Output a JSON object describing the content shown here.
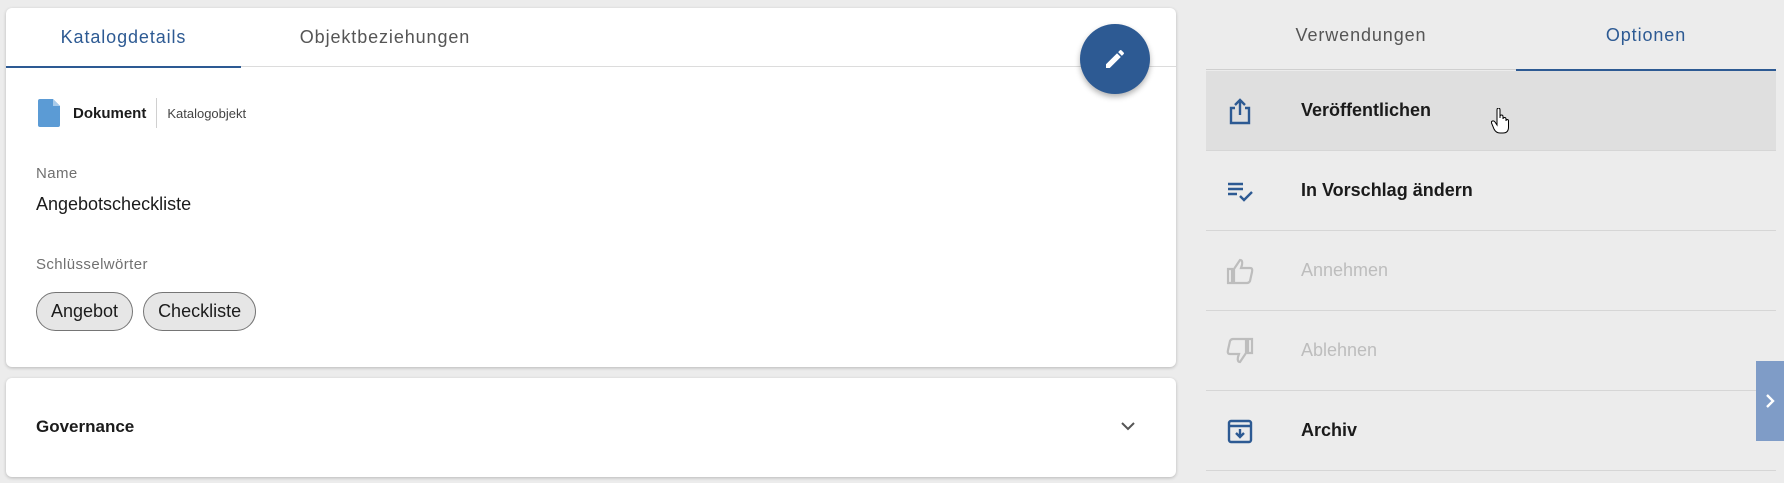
{
  "left_tabs": [
    {
      "label": "Katalogdetails",
      "active": true
    },
    {
      "label": "Objektbeziehungen",
      "active": false
    }
  ],
  "edit_button": {
    "icon": "pencil-icon"
  },
  "object_type": {
    "label": "Dokument",
    "sub_label": "Katalogobjekt",
    "icon": "document-icon"
  },
  "fields": {
    "name_label": "Name",
    "name_value": "Angebotscheckliste",
    "keywords_label": "Schlüsselwörter",
    "keywords": [
      "Angebot",
      "Checkliste"
    ]
  },
  "governance": {
    "title": "Governance",
    "icon": "chevron-down-icon"
  },
  "right_tabs": [
    {
      "label": "Verwendungen",
      "active": false
    },
    {
      "label": "Optionen",
      "active": true
    }
  ],
  "options": [
    {
      "label": "Veröffentlichen",
      "icon": "share-upload-icon",
      "enabled": true,
      "hovered": true
    },
    {
      "label": "In Vorschlag ändern",
      "icon": "playlist-check-icon",
      "enabled": true,
      "hovered": false
    },
    {
      "label": "Annehmen",
      "icon": "thumb-up-icon",
      "enabled": false,
      "hovered": false
    },
    {
      "label": "Ablehnen",
      "icon": "thumb-down-icon",
      "enabled": false,
      "hovered": false
    },
    {
      "label": "Archiv",
      "icon": "archive-icon",
      "enabled": true,
      "hovered": false
    }
  ],
  "colors": {
    "accent": "#2d5a93",
    "doc_icon": "#5b9bd5",
    "disabled": "#bdbdbd",
    "background": "#ececec",
    "collapse_tab": "#7f9cc7"
  }
}
